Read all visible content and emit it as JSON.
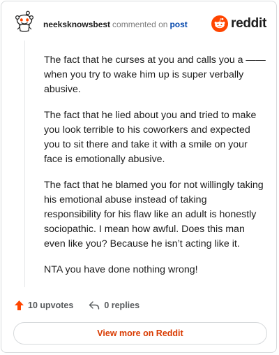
{
  "header": {
    "username": "neeksknowsbest",
    "action_text": "commented on",
    "post_link": "post",
    "brand_name": "reddit",
    "brand_color": "#ff4500",
    "avatar_icon": "reddit-snoo-avatar-icon",
    "logo_icon": "reddit-alien-logo-icon"
  },
  "comment": {
    "paragraphs": [
      "The fact that he curses at you and calls you a —— when you try to wake him up is super verbally abusive.",
      "The fact that he lied about you and tried to make you look terrible to his coworkers and expected you to sit there and take it with a smile on your face is emotionally abusive.",
      "The fact that he blamed you for not willingly taking his emotional abuse instead of taking responsibility for his flaw like an adult is honestly sociopathic. I mean how awful. Does this man even like you? Because he isn’t acting like it.",
      "NTA you have done nothing wrong!"
    ]
  },
  "footer": {
    "upvotes": "10 upvotes",
    "replies": "0 replies",
    "upvote_icon": "upvote-arrow-icon",
    "reply_icon": "reply-arrow-icon",
    "upvote_color": "#ff4500"
  },
  "cta": {
    "label": "View more on Reddit",
    "color": "#d93a00"
  }
}
